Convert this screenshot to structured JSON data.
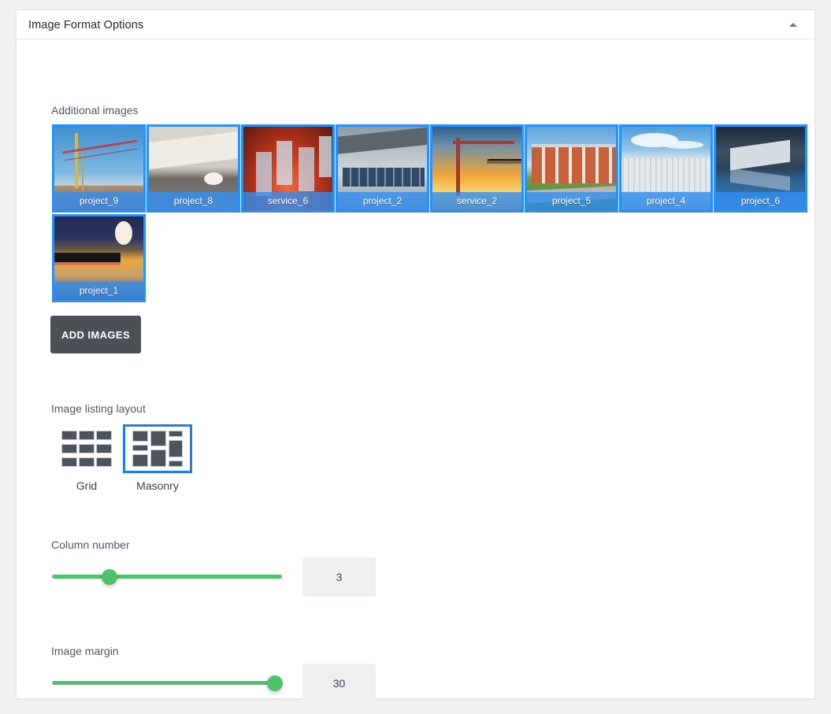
{
  "panel": {
    "title": "Image Format Options",
    "collapse_icon": "caret-up-icon"
  },
  "additional_images": {
    "label": "Additional images",
    "thumbnails": [
      {
        "label": "project_9",
        "art": "ph-crane-day"
      },
      {
        "label": "project_8",
        "art": "ph-modern"
      },
      {
        "label": "service_6",
        "art": "ph-towers"
      },
      {
        "label": "project_2",
        "art": "ph-solar"
      },
      {
        "label": "service_2",
        "art": "ph-sunset"
      },
      {
        "label": "project_5",
        "art": "ph-brick"
      },
      {
        "label": "project_4",
        "art": "ph-warehouse"
      },
      {
        "label": "project_6",
        "art": "ph-harbor"
      },
      {
        "label": "project_1",
        "art": "ph-night"
      }
    ],
    "add_button_label": "ADD IMAGES"
  },
  "listing_layout": {
    "label": "Image listing layout",
    "options": [
      {
        "label": "Grid",
        "icon": "grid-layout-icon",
        "selected": false
      },
      {
        "label": "Masonry",
        "icon": "masonry-layout-icon",
        "selected": true
      }
    ]
  },
  "column_number": {
    "label": "Column number",
    "value": "3"
  },
  "image_margin": {
    "label": "Image margin",
    "value": "30"
  },
  "colors": {
    "accent_blue": "#2f8ef4",
    "selected_border": "#1d7ee8",
    "slider_green": "#4ec16a",
    "button_dark": "#4a5055",
    "panel_bg": "#ffffff",
    "page_bg": "#f0f0f0"
  }
}
